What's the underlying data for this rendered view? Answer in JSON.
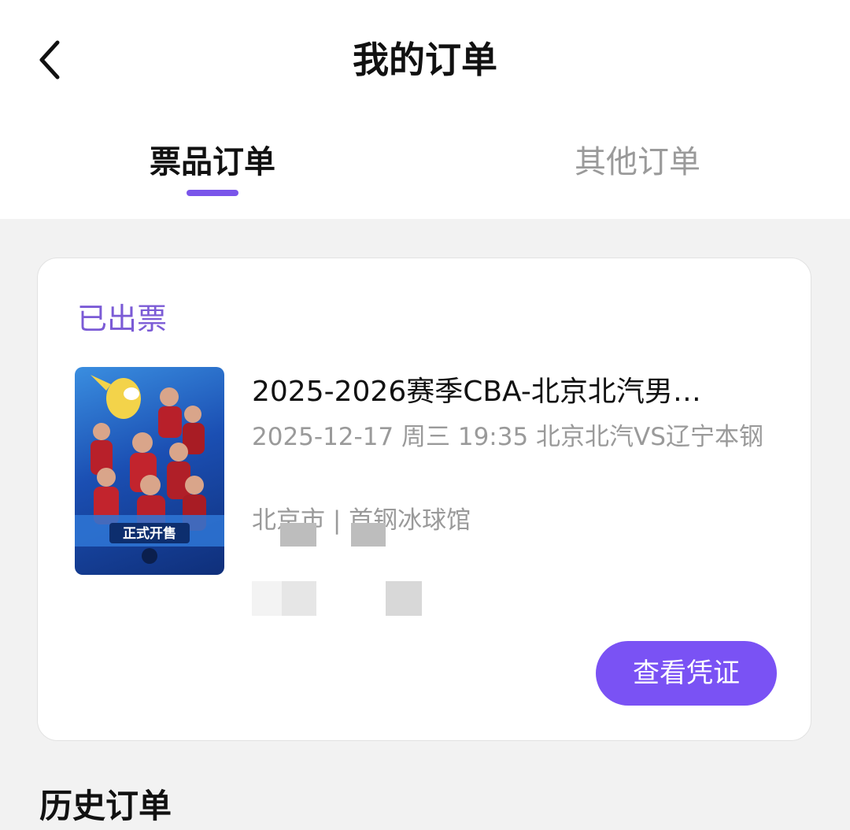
{
  "header": {
    "title": "我的订单",
    "back_icon": "chevron-left-icon"
  },
  "tabs": [
    {
      "label": "票品订单",
      "active": true
    },
    {
      "label": "其他订单",
      "active": false
    }
  ],
  "order": {
    "status": "已出票",
    "title": "2025-2026赛季CBA-北京北汽男…",
    "datetime_line": "2025-12-17 周三 19:35 北京北汽VS辽宁本钢",
    "venue": "北京市 | 首钢冰球馆",
    "button_label": "查看凭证",
    "poster_text": "正式开售"
  },
  "section": {
    "heading": "历史订单"
  },
  "colors": {
    "accent": "#7a52f4",
    "status_text": "#7b5bd6",
    "muted_text": "#9a9a9a",
    "background": "#f2f2f2"
  }
}
